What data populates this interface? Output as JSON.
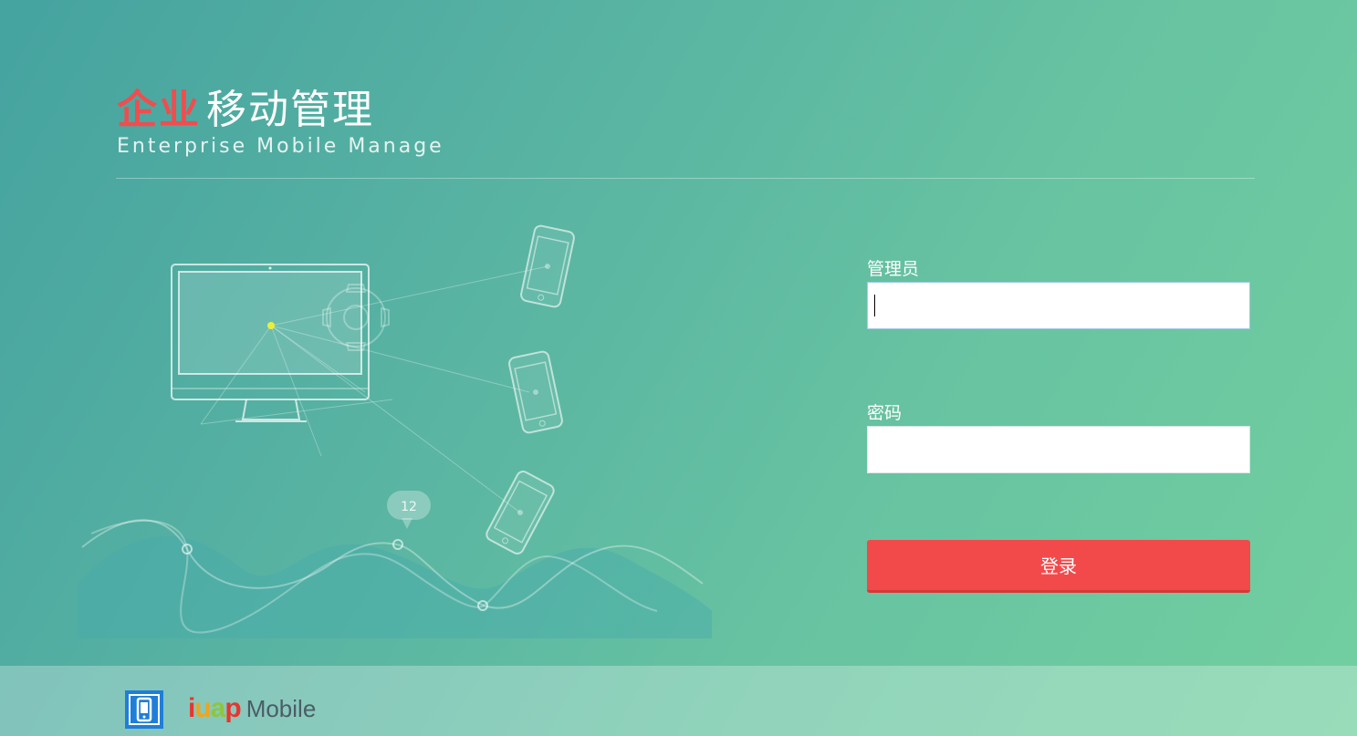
{
  "header": {
    "title_accent": "企业",
    "title_rest": "移动管理",
    "subtitle": "Enterprise Mobile Manage"
  },
  "illustration": {
    "bubble_count": "12"
  },
  "form": {
    "username_label": "管理员",
    "username_value": "",
    "password_label": "密码",
    "password_value": "",
    "login_label": "登录"
  },
  "footer": {
    "brand_name": "iuap",
    "brand_suffix": "Mobile"
  },
  "colors": {
    "accent_red": "#f04d4f",
    "button_red": "#f24a4b",
    "bg_start": "#45a3a0",
    "bg_end": "#72cfa0",
    "brand_blue": "#1f7ed8"
  },
  "icons": {
    "footer_icon": "mobile-device-icon"
  }
}
